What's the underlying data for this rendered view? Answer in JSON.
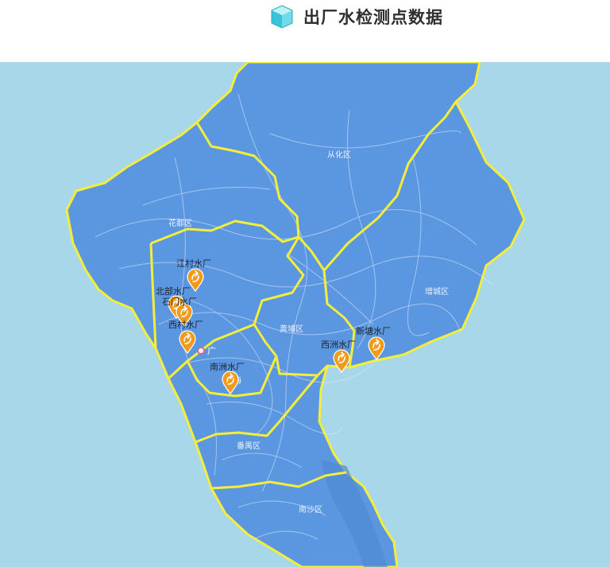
{
  "header": {
    "title": "出厂水检测点数据",
    "icon": "cube-icon"
  },
  "map": {
    "colors": {
      "sea": "#a9d7ea",
      "land": "#5b97e0",
      "border": "#f4ee3b",
      "pin": "#f39a1a"
    },
    "districts": {
      "conghua": "从化区",
      "huadu": "花都区",
      "zengcheng": "增城区",
      "huangpu": "黄埔区",
      "panyu": "番禺区",
      "nansha": "南沙区",
      "haizhu": "海"
    },
    "city_marker": "广",
    "plants": [
      "江村水厂",
      "北部水厂",
      "石门水厂",
      "西村水厂",
      "南洲水厂",
      "西洲水厂",
      "新塘水厂"
    ]
  }
}
